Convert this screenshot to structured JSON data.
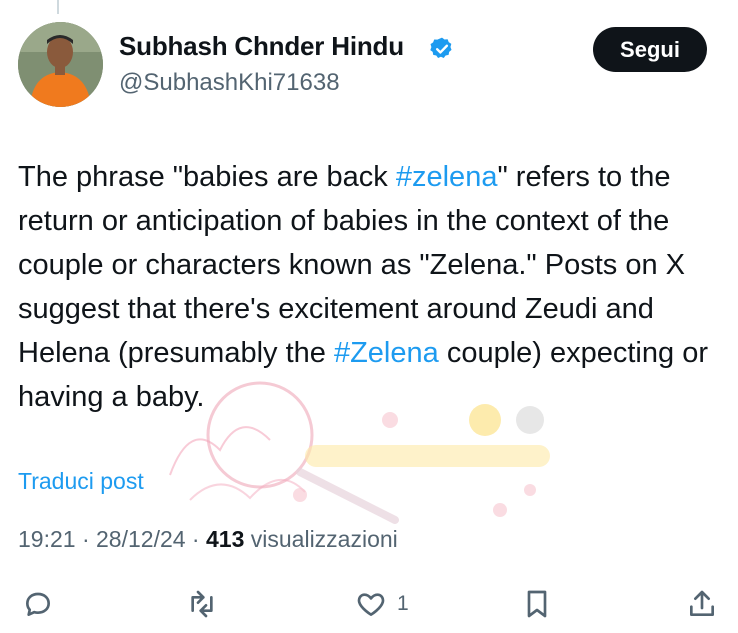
{
  "author": {
    "display_name": "Subhash Chnder Hindu",
    "handle": "@SubhashKhi71638",
    "verified": true,
    "avatar_icon": "profile-photo"
  },
  "header": {
    "follow_label": "Segui"
  },
  "post": {
    "parts": [
      {
        "text": "The phrase \"babies are back ",
        "hashtag": false
      },
      {
        "text": "#zelena",
        "hashtag": true
      },
      {
        "text": "\" refers to the return or anticipation of babies in the context of the couple or characters known as \"Zelena.\" Posts on X suggest that there's excitement around Zeudi and Helena (presumably the ",
        "hashtag": false
      },
      {
        "text": "#Zelena",
        "hashtag": true
      },
      {
        "text": " couple) expecting or having a baby.",
        "hashtag": false
      }
    ]
  },
  "translate_label": "Traduci post",
  "meta": {
    "time": "19:21",
    "separator": " · ",
    "date": "28/12/24",
    "views_count": "413",
    "views_label": " visualizzazioni"
  },
  "actions": {
    "reply_icon": "reply-icon",
    "repost_icon": "repost-icon",
    "like_icon": "heart-icon",
    "like_count": "1",
    "bookmark_icon": "bookmark-icon",
    "share_icon": "share-icon"
  },
  "colors": {
    "accent": "#1d9bf0",
    "text": "#0f1419",
    "secondary": "#536471"
  }
}
